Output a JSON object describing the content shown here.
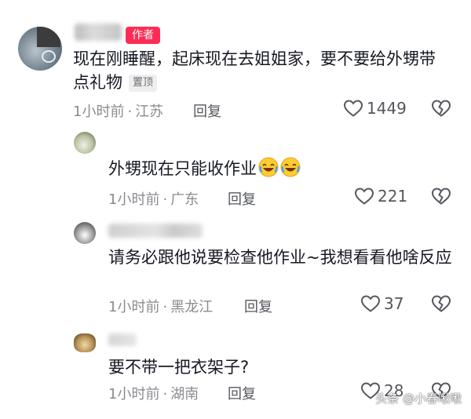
{
  "main_comment": {
    "author_badge": "作者",
    "text": "现在刚睡醒，起床现在去姐姐家，要不要给外甥带点礼物",
    "pinned_label": "置顶",
    "time": "1小时前",
    "location": "江苏",
    "reply_label": "回复",
    "likes": "1449",
    "icon_like": "heart-outline-icon",
    "icon_dislike": "broken-heart-icon"
  },
  "replies": [
    {
      "text": "外甥现在只能收作业",
      "emoji": "rolling-laughing-emoji",
      "time": "1小时前",
      "location": "广东",
      "reply_label": "回复",
      "likes": "221"
    },
    {
      "text": "请务必跟他说要检查他作业~我想看看他啥反应",
      "time": "1小时前",
      "location": "黑龙江",
      "reply_label": "回复",
      "likes": "37"
    },
    {
      "text": "要不带一把衣架子?",
      "time": "1小时前",
      "location": "湖南",
      "reply_label": "回复",
      "likes": "28"
    }
  ],
  "separator": "·",
  "watermark": "头条 @小春啾啾",
  "colors": {
    "author_badge_bg": "#fe2c55",
    "meta_text": "#8a8b91",
    "body_text": "#161823"
  }
}
